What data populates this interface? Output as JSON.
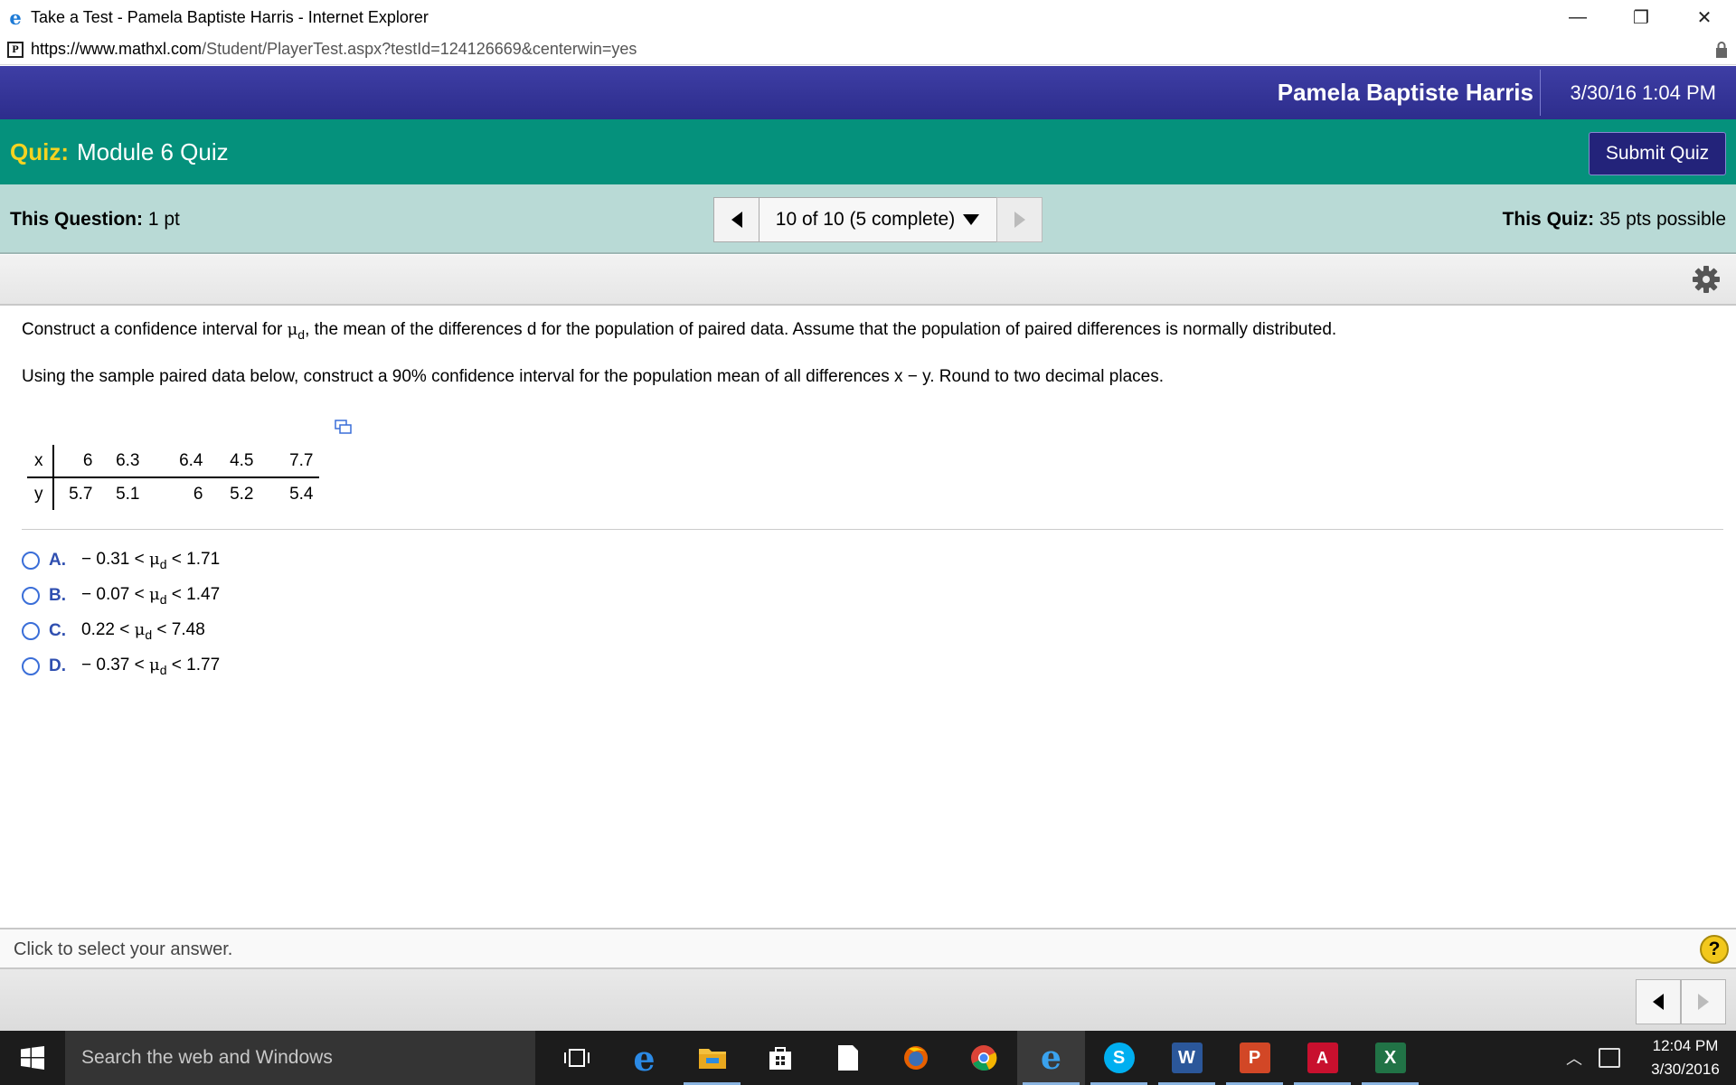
{
  "window": {
    "title": "Take a Test - Pamela Baptiste Harris - Internet Explorer",
    "url_main": "https://www.mathxl.com",
    "url_path": "/Student/PlayerTest.aspx?testId=124126669&centerwin=yes",
    "controls": {
      "minimize": "—",
      "restore": "❐",
      "close": "✕"
    }
  },
  "header": {
    "user_name": "Pamela Baptiste Harris",
    "date_time": "3/30/16 1:04 PM"
  },
  "quiz": {
    "label": "Quiz:",
    "name": "Module 6 Quiz",
    "submit_label": "Submit Quiz"
  },
  "info": {
    "question_label": "This Question:",
    "question_points": "1 pt",
    "nav_status": "10 of 10 (5 complete)",
    "quiz_label": "This Quiz:",
    "quiz_points": "35 pts possible"
  },
  "question": {
    "line1_a": "Construct a confidence interval for ",
    "line1_mu": "μ",
    "line1_sub": "d",
    "line1_b": ", the mean of the differences d for the population of paired data. Assume that the population of paired differences is normally distributed.",
    "line2": "Using the sample paired data below, construct a 90% confidence interval for the population mean of all differences x − y. Round to two decimal places.",
    "table": {
      "x_label": "x",
      "y_label": "y",
      "x_values": [
        "6",
        "6.3",
        "6.4",
        "4.5",
        "7.7"
      ],
      "y_values": [
        "5.7",
        "5.1",
        "6",
        "5.2",
        "5.4"
      ]
    },
    "options": [
      {
        "letter": "A.",
        "left": "− 0.31 < ",
        "mu": "μ",
        "sub": "d",
        "right": " < 1.71"
      },
      {
        "letter": "B.",
        "left": "− 0.07 < ",
        "mu": "μ",
        "sub": "d",
        "right": " < 1.47"
      },
      {
        "letter": "C.",
        "left": "0.22 < ",
        "mu": "μ",
        "sub": "d",
        "right": " < 7.48"
      },
      {
        "letter": "D.",
        "left": "− 0.37 < ",
        "mu": "μ",
        "sub": "d",
        "right": " < 1.77"
      }
    ]
  },
  "status": {
    "text": "Click to select your answer.",
    "help_symbol": "?"
  },
  "taskbar": {
    "search_placeholder": "Search the web and Windows",
    "clock_time": "12:04 PM",
    "clock_date": "3/30/2016",
    "app_icons": [
      "task-view-icon",
      "edge-icon",
      "file-explorer-icon",
      "store-icon",
      "document-icon",
      "firefox-icon",
      "chrome-icon",
      "internet-explorer-icon",
      "skype-icon",
      "word-icon",
      "powerpoint-icon",
      "acrobat-icon",
      "excel-icon"
    ]
  },
  "colors": {
    "header_blue": "#2d2d8c",
    "quiz_teal": "#05917c",
    "quiz_label_yellow": "#f5d321",
    "info_bar": "#b9dad6",
    "option_letter": "#2f4fb0",
    "help_yellow": "#f2c81d"
  }
}
